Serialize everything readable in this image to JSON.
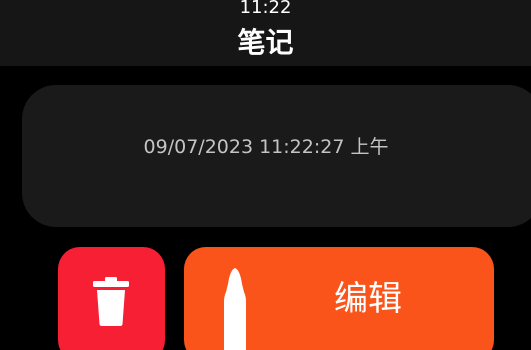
{
  "status_bar": {
    "time": "11:22"
  },
  "header": {
    "title": "笔记"
  },
  "note": {
    "timestamp": "09/07/2023 11:22:27 上午"
  },
  "actions": {
    "delete_icon": "trash-icon",
    "edit_icon": "pencil-icon",
    "edit_label": "编辑"
  },
  "colors": {
    "background": "#000000",
    "header": "#161616",
    "card": "#1a1a1a",
    "delete": "#f61f34",
    "edit": "#fa541b",
    "text": "#ffffff",
    "muted_text": "#c4c4c4"
  }
}
